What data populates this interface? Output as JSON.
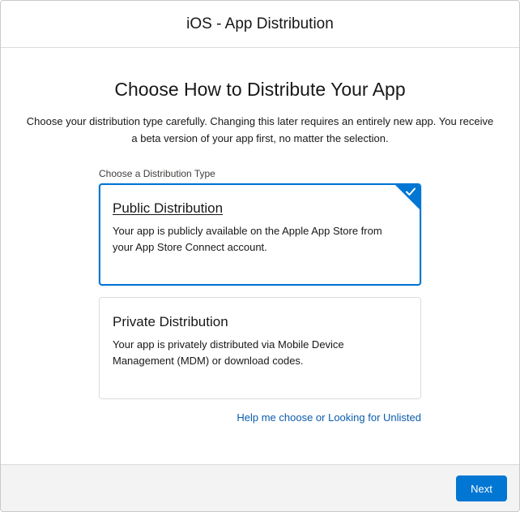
{
  "header": {
    "title": "iOS - App Distribution"
  },
  "main": {
    "title": "Choose How to Distribute Your App",
    "description": "Choose your distribution type carefully. Changing this later requires an entirely new app. You receive a beta version of your app first, no matter the selection.",
    "section_label": "Choose a Distribution Type",
    "options": [
      {
        "title": "Public Distribution",
        "description": "Your app is publicly available on the Apple App Store from your App Store Connect account.",
        "selected": true
      },
      {
        "title": "Private Distribution",
        "description": "Your app is privately distributed via Mobile Device Management (MDM) or download codes.",
        "selected": false
      }
    ],
    "help_link": "Help me choose or Looking for Unlisted"
  },
  "footer": {
    "next_label": "Next"
  },
  "colors": {
    "accent": "#0176d3",
    "link": "#0b5cab",
    "footer_bg": "#f3f3f3",
    "border": "#dddbda"
  },
  "icons": {
    "selected_indicator": "checkmark-icon"
  }
}
